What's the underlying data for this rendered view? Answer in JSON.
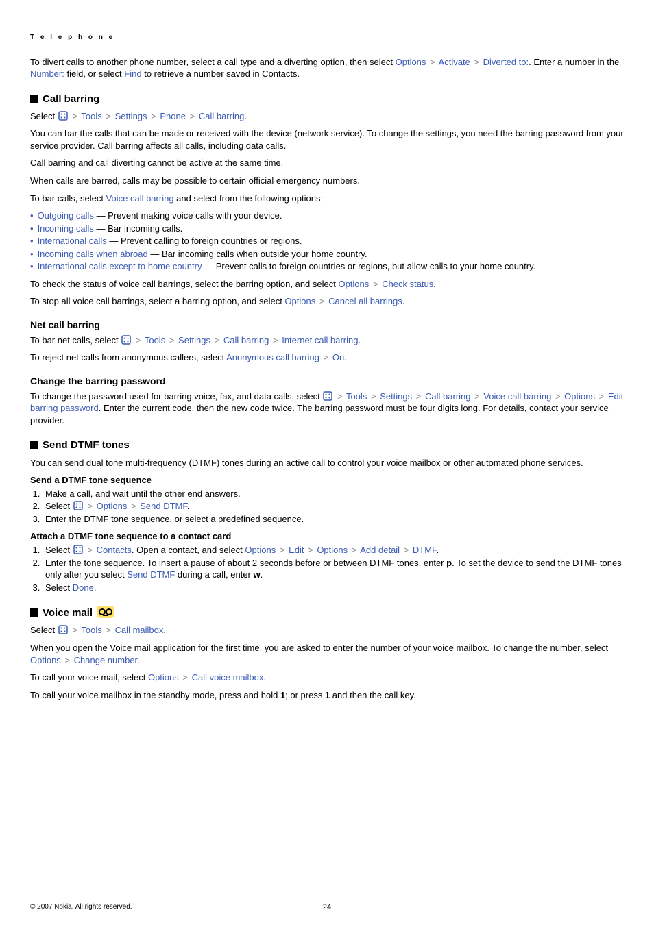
{
  "header": "T e l e p h o n e",
  "intro_divert": {
    "t1": "To divert calls to another phone number, select a call type and a diverting option, then select ",
    "l1": "Options",
    "l2": "Activate",
    "l3": "Diverted to:",
    "t2": ". Enter a number in the ",
    "l4": "Number:",
    "t3": " field, or select ",
    "l5": "Find",
    "t4": " to retrieve a number saved in Contacts."
  },
  "call_barring": {
    "title": "Call barring",
    "select": {
      "pre": "Select ",
      "l1": "Tools",
      "l2": "Settings",
      "l3": "Phone",
      "l4": "Call barring",
      "post": "."
    },
    "p1": "You can bar the calls that can be made or received with the device (network service). To change the settings, you need the barring password from your service provider. Call barring affects all calls, including data calls.",
    "p2": "Call barring and call diverting cannot be active at the same time.",
    "p3": "When calls are barred, calls may be possible to certain official emergency numbers.",
    "p4_pre": "To bar calls, select ",
    "p4_link": "Voice call barring",
    "p4_post": " and select from the following options:",
    "opts": [
      {
        "l": "Outgoing calls",
        "t": " — Prevent making voice calls with your device."
      },
      {
        "l": "Incoming calls",
        "t": " — Bar incoming calls."
      },
      {
        "l": "International calls",
        "t": " — Prevent calling to foreign countries or regions."
      },
      {
        "l": "Incoming calls when abroad",
        "t": " — Bar incoming calls when outside your home country."
      },
      {
        "l": "International calls except to home country",
        "t": " — Prevent calls to foreign countries or regions, but allow calls to your home country."
      }
    ],
    "status": {
      "pre": "To check the status of voice call barrings, select the barring option, and select ",
      "l1": "Options",
      "l2": "Check status",
      "post": "."
    },
    "stop": {
      "pre": "To stop all voice call barrings, select a barring option, and select ",
      "l1": "Options",
      "l2": "Cancel all barrings",
      "post": "."
    }
  },
  "net": {
    "title": "Net call barring",
    "p1": {
      "pre": "To bar net calls, select ",
      "l1": "Tools",
      "l2": "Settings",
      "l3": "Call barring",
      "l4": "Internet call barring",
      "post": "."
    },
    "p2": {
      "pre": "To reject net calls from anonymous callers, select ",
      "l1": "Anonymous call barring",
      "l2": "On",
      "post": "."
    }
  },
  "pwd": {
    "title": "Change the barring password",
    "p1_a": "To change the password used for barring voice, fax, and data calls, select ",
    "l1": "Tools",
    "l2": "Settings",
    "l3": "Call barring",
    "l4": "Voice call barring",
    "l5": "Options",
    "l6": "Edit barring password",
    "p1_b": ". Enter the current code, then the new code twice. The barring password must be four digits long. For details, contact your service provider."
  },
  "dtmf": {
    "title": "Send DTMF tones",
    "p1": "You can send dual tone multi-frequency (DTMF) tones during an active call to control your voice mailbox or other automated phone services.",
    "sub1": "Send a DTMF tone sequence",
    "s1": "Make a call, and wait until the other end answers.",
    "s2_pre": "Select ",
    "s2_l1": "Options",
    "s2_l2": "Send DTMF",
    "s2_post": ".",
    "s3": "Enter the DTMF tone sequence, or select a predefined sequence.",
    "sub2": "Attach a DTMF tone sequence to a contact card",
    "a1_pre": "Select ",
    "a1_l1": "Contacts",
    "a1_mid": ". Open a contact, and select ",
    "a1_l2": "Options",
    "a1_l3": "Edit",
    "a1_l4": "Options",
    "a1_l5": "Add detail",
    "a1_l6": "DTMF",
    "a1_post": ".",
    "a2_pre": "Enter the tone sequence. To insert a pause of about 2 seconds before or between DTMF tones, enter ",
    "a2_k1": "p",
    "a2_mid": ". To set the device to send the DTMF tones only after you select ",
    "a2_l1": "Send DTMF",
    "a2_mid2": " during a call, enter ",
    "a2_k2": "w",
    "a2_post": ".",
    "a3_pre": "Select ",
    "a3_l1": "Done",
    "a3_post": "."
  },
  "vm": {
    "title": "Voice mail",
    "select": {
      "pre": "Select ",
      "l1": "Tools",
      "l2": "Call mailbox",
      "post": "."
    },
    "p1_pre": "When you open the Voice mail application for the first time, you are asked to enter the number of your voice mailbox. To change the number, select ",
    "p1_l1": "Options",
    "p1_l2": "Change number",
    "p1_post": ".",
    "p2_pre": "To call your voice mail, select ",
    "p2_l1": "Options",
    "p2_l2": "Call voice mailbox",
    "p2_post": ".",
    "p3_pre": "To call your voice mailbox in the standby mode, press and hold ",
    "p3_k1": "1",
    "p3_mid": "; or press ",
    "p3_k2": "1",
    "p3_post": " and then the call key."
  },
  "footer": {
    "copy": "© 2007 Nokia. All rights reserved.",
    "page": "24"
  }
}
